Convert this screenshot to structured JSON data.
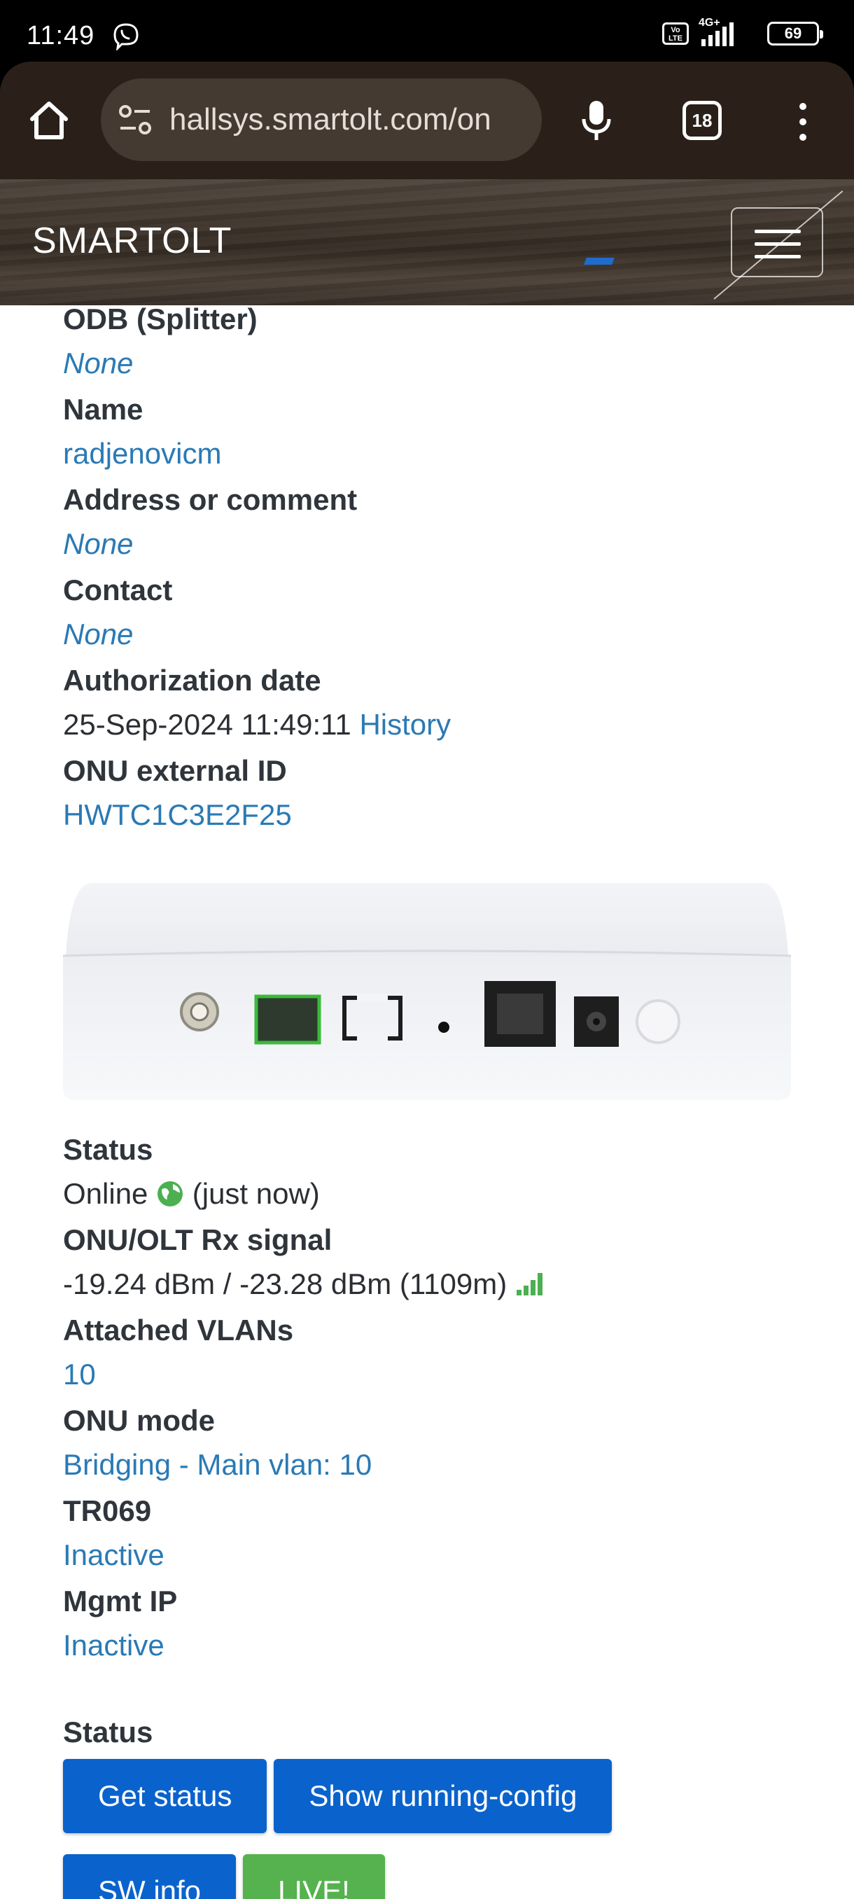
{
  "statusbar": {
    "time": "11:49",
    "volte": "Vo LTE",
    "network": "4G+",
    "battery": "69"
  },
  "browser": {
    "url": "hallsys.smartolt.com/on",
    "tab_count": "18"
  },
  "header": {
    "brand": "SMARTOLT"
  },
  "fields_top": [
    {
      "label": "ODB (Splitter)",
      "value": "None",
      "style": "italic-link"
    },
    {
      "label": "Name",
      "value": "radjenovicm",
      "style": "link"
    },
    {
      "label": "Address or comment",
      "value": "None",
      "style": "italic-link"
    },
    {
      "label": "Contact",
      "value": "None",
      "style": "italic-link"
    }
  ],
  "auth": {
    "label": "Authorization date",
    "date": "25-Sep-2024 11:49:11",
    "history_link": "History"
  },
  "external_id": {
    "label": "ONU external ID",
    "value": "HWTC1C3E2F25"
  },
  "onu_status": {
    "label": "Status",
    "value": "Online",
    "suffix": "(just now)"
  },
  "rx_signal": {
    "label": "ONU/OLT Rx signal",
    "value": "-19.24 dBm / -23.28 dBm (1109m)"
  },
  "fields_bottom": [
    {
      "label": "Attached VLANs",
      "value": "10"
    },
    {
      "label": "ONU mode",
      "value": "Bridging - Main vlan: 10"
    },
    {
      "label": "TR069",
      "value": "Inactive"
    },
    {
      "label": "Mgmt IP",
      "value": "Inactive"
    }
  ],
  "actions": {
    "title": "Status",
    "get_status": "Get status",
    "show_running_config": "Show running-config",
    "sw_info": "SW info",
    "live": "LIVE!"
  },
  "colors": {
    "link": "#2a7ab5",
    "primary_button": "#0a63cc",
    "success_button": "#55b24e",
    "online_green": "#4caf50"
  }
}
